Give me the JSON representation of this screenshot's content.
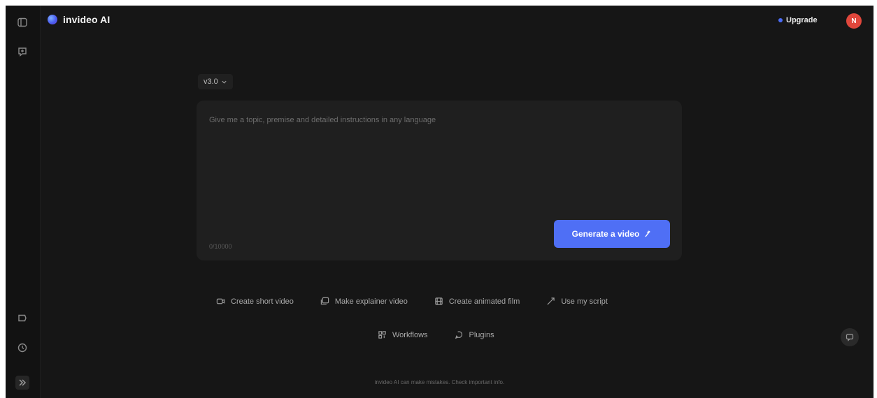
{
  "header": {
    "brand_name": "invideo AI",
    "upgrade_label": "Upgrade",
    "avatar_initial": "N"
  },
  "composer": {
    "version_label": "v3.0",
    "prompt_placeholder": "Give me a topic, premise and detailed instructions in any language",
    "char_count": "0/10000",
    "generate_label": "Generate a video"
  },
  "actions": {
    "row1": [
      {
        "label": "Create short video",
        "icon": "video-camera-icon"
      },
      {
        "label": "Make explainer video",
        "icon": "explainer-icon"
      },
      {
        "label": "Create animated film",
        "icon": "film-icon"
      },
      {
        "label": "Use my script",
        "icon": "script-icon"
      }
    ],
    "row2": [
      {
        "label": "Workflows",
        "icon": "workflows-icon"
      },
      {
        "label": "Plugins",
        "icon": "plugins-icon"
      }
    ]
  },
  "footer": {
    "disclaimer": "invideo AI can make mistakes. Check important info."
  },
  "colors": {
    "accent": "#4f6ff5",
    "background": "#161616",
    "card": "#1f1f1f",
    "avatar": "#e0473c"
  }
}
